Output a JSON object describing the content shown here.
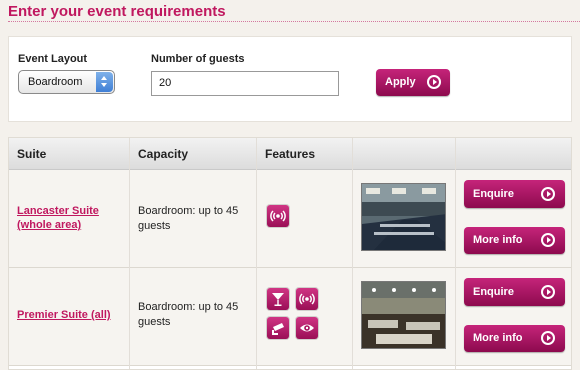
{
  "heading": "Enter your event requirements",
  "filters": {
    "layout_label": "Event Layout",
    "layout_value": "Boardroom",
    "guests_label": "Number of guests",
    "guests_value": "20",
    "apply_label": "Apply"
  },
  "table": {
    "headers": [
      "Suite",
      "Capacity",
      "Features",
      "",
      ""
    ],
    "rows": [
      {
        "suite_line1": "Lancaster Suite",
        "suite_line2": "(whole area)",
        "capacity_line1": "Boardroom: up to 45",
        "capacity_line2": "guests",
        "features": [
          "wifi-icon"
        ],
        "enquire_label": "Enquire",
        "more_info_label": "More info"
      },
      {
        "suite_line1": "Premier Suite (all)",
        "capacity_line1": "Boardroom: up to 45",
        "capacity_line2": "guests",
        "features": [
          "cocktail-bar-icon",
          "wifi-icon",
          "cctv-camera-icon",
          "viewing-eye-icon"
        ],
        "enquire_label": "Enquire",
        "more_info_label": "More info"
      }
    ]
  },
  "colors": {
    "accent": "#c0185f",
    "button": "#a51163",
    "background": "#f4f1ec"
  }
}
